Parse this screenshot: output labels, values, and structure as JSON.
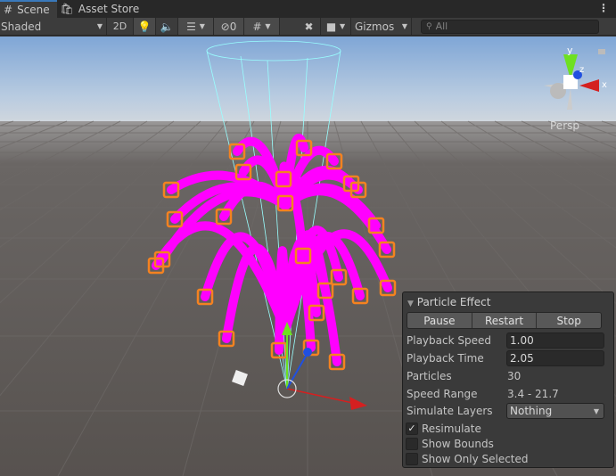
{
  "tabs": [
    {
      "label": "Scene",
      "icon": "grid-icon"
    },
    {
      "label": "Asset Store",
      "icon": "shopping-bag-icon"
    }
  ],
  "toolbar": {
    "shading_mode": "Shaded",
    "mode_2d": "2D",
    "hidden_count": "0",
    "gizmos": "Gizmos",
    "search_placeholder": "All"
  },
  "orientation_gizmo": {
    "x": "x",
    "y": "y",
    "z": "z",
    "projection": "Persp"
  },
  "particle_panel": {
    "title": "Particle Effect",
    "buttons": [
      "Pause",
      "Restart",
      "Stop"
    ],
    "playback_speed_label": "Playback Speed",
    "playback_speed": "1.00",
    "playback_time_label": "Playback Time",
    "playback_time": "2.05",
    "particles_label": "Particles",
    "particles": "30",
    "speed_range_label": "Speed Range",
    "speed_range": "3.4 - 21.7",
    "simulate_layers_label": "Simulate Layers",
    "simulate_layers": "Nothing",
    "checkboxes": [
      {
        "label": "Resimulate",
        "checked": true
      },
      {
        "label": "Show Bounds",
        "checked": false
      },
      {
        "label": "Show Only Selected",
        "checked": false
      }
    ]
  },
  "colors": {
    "particle": "#ff00ff",
    "selection": "#f58220",
    "x_axis": "#d42020",
    "y_axis": "#6ee020",
    "z_axis": "#2050e0"
  }
}
